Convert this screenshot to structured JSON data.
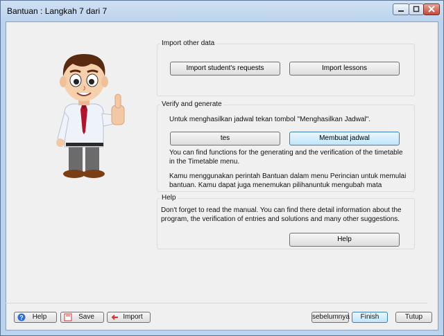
{
  "window": {
    "title": "Bantuan : Langkah 7 dari 7"
  },
  "import_group": {
    "title": "Import other data",
    "students_btn": "Import student's requests",
    "lessons_btn": "Import lessons"
  },
  "verify_group": {
    "title": "Verify and generate",
    "instruction": "Untuk menghasilkan jadwal tekan tombol \"Menghasilkan Jadwal\".",
    "tes_btn": "tes",
    "generate_btn": "Membuat jadwal",
    "info1": "You can find functions for the generating and the verification of the timetable in the Timetable menu.",
    "info2": "Kamu menggunakan perintah Bantuan dalam menu Perincian untuk memulai bantuan. Kamu dapat juga menemukan pilihanuntuk mengubah mata pelajaran,  kelas guru di sana. Kamu"
  },
  "help_group": {
    "title": "Help",
    "text": "Don't forget to read the manual. You can find there detail information about the program, the verification of entries and solutions and many other suggestions.",
    "help_btn": "Help"
  },
  "footer": {
    "help": "Help",
    "save": "Save",
    "import": "Import",
    "prev": "sebelumnya",
    "finish": "Finish",
    "close": "Tutup"
  }
}
